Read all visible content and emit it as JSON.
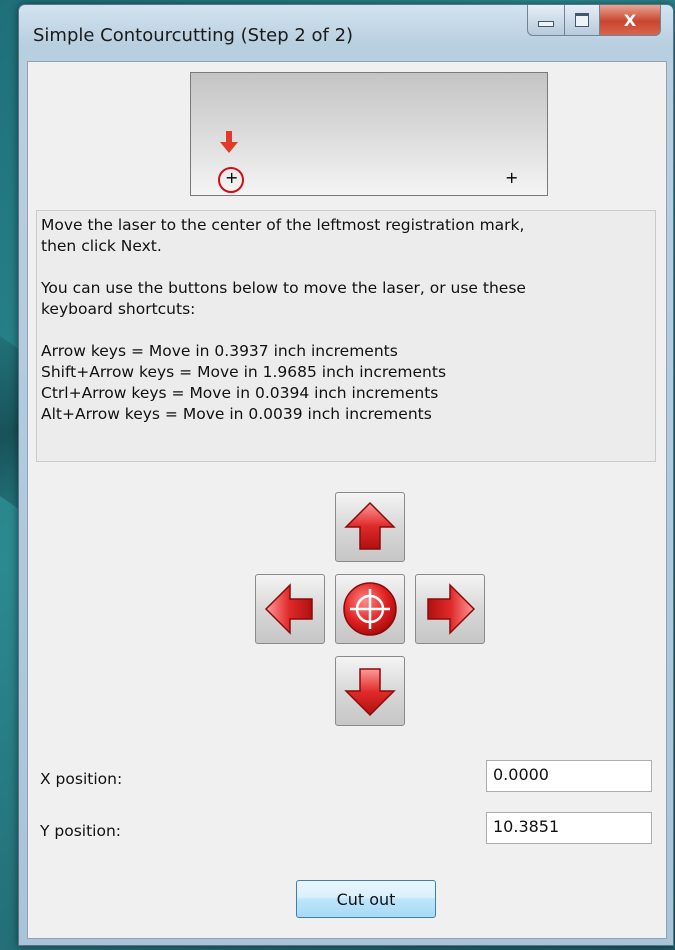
{
  "window": {
    "title": "Simple Contourcutting (Step 2 of 2)",
    "close_glyph": "X"
  },
  "preview": {
    "left_mark": "+",
    "right_mark": "+"
  },
  "instructions": {
    "line1": "Move the laser to the center of the leftmost registration mark,",
    "line2": "then click Next.",
    "line3": "You can use the buttons below to move the laser, or use these",
    "line4": "keyboard shortcuts:",
    "shortcut1": "Arrow keys = Move in 0.3937 inch increments",
    "shortcut2": "Shift+Arrow keys = Move in 1.9685 inch increments",
    "shortcut3": "Ctrl+Arrow keys = Move in 0.0394 inch increments",
    "shortcut4": "Alt+Arrow keys = Move in 0.0039 inch increments"
  },
  "icons": {
    "up": "arrow-up-icon",
    "down": "arrow-down-icon",
    "left": "arrow-left-icon",
    "right": "arrow-right-icon",
    "center": "crosshair-icon",
    "accent": "#e02a2a"
  },
  "fields": {
    "x_label": "X position:",
    "x_value": "0.0000",
    "y_label": "Y position:",
    "y_value": "10.3851"
  },
  "buttons": {
    "cut_out": "Cut out"
  }
}
